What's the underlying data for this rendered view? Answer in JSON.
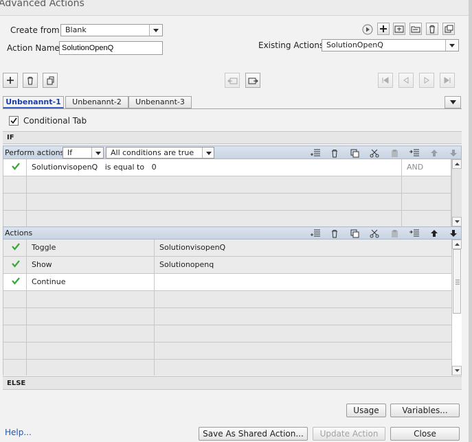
{
  "window": {
    "title": "Advanced Actions"
  },
  "form": {
    "create_from_label": "Create from:",
    "create_from_value": "Blank",
    "action_name_label": "Action Name:",
    "action_name_value": "SolutionOpenQ",
    "existing_actions_label": "Existing Actions:",
    "existing_actions_value": "SolutionOpenQ"
  },
  "tabs": [
    {
      "label": "Unbenannt-1",
      "active": true
    },
    {
      "label": "Unbenannt-2",
      "active": false
    },
    {
      "label": "Unbenannt-3",
      "active": false
    }
  ],
  "conditional_tab": {
    "label": "Conditional Tab",
    "checked": true
  },
  "if_section": {
    "header": "IF",
    "perform_label": "Perform actions:",
    "perform_value": "If",
    "conditions_value": "All conditions are true",
    "rows": [
      {
        "variable": "SolutionvisopenQ",
        "operator": "is equal to",
        "value": "0",
        "logic": "AND",
        "checked": true
      },
      {
        "variable": "",
        "operator": "",
        "value": "",
        "logic": "",
        "checked": false
      },
      {
        "variable": "",
        "operator": "",
        "value": "",
        "logic": "",
        "checked": false
      },
      {
        "variable": "",
        "operator": "",
        "value": "",
        "logic": "",
        "checked": false
      }
    ]
  },
  "actions_section": {
    "header": "Actions",
    "rows": [
      {
        "action": "Toggle",
        "target": "SolutionvisopenQ",
        "checked": true
      },
      {
        "action": "Show",
        "target": "Solutionopenq",
        "checked": true
      },
      {
        "action": "Continue",
        "target": "",
        "checked": true
      },
      {
        "action": "",
        "target": "",
        "checked": false
      },
      {
        "action": "",
        "target": "",
        "checked": false
      },
      {
        "action": "",
        "target": "",
        "checked": false
      },
      {
        "action": "",
        "target": "",
        "checked": false
      },
      {
        "action": "",
        "target": "",
        "checked": false
      }
    ]
  },
  "else_section": {
    "header": "ELSE"
  },
  "footer": {
    "usage": "Usage",
    "variables": "Variables...",
    "help": "Help...",
    "save_shared": "Save As Shared Action...",
    "update": "Update Action",
    "close": "Close"
  },
  "colors": {
    "accent": "#1a3ea8",
    "check": "#3aa53a",
    "grid_header": "#cfd9e6"
  }
}
